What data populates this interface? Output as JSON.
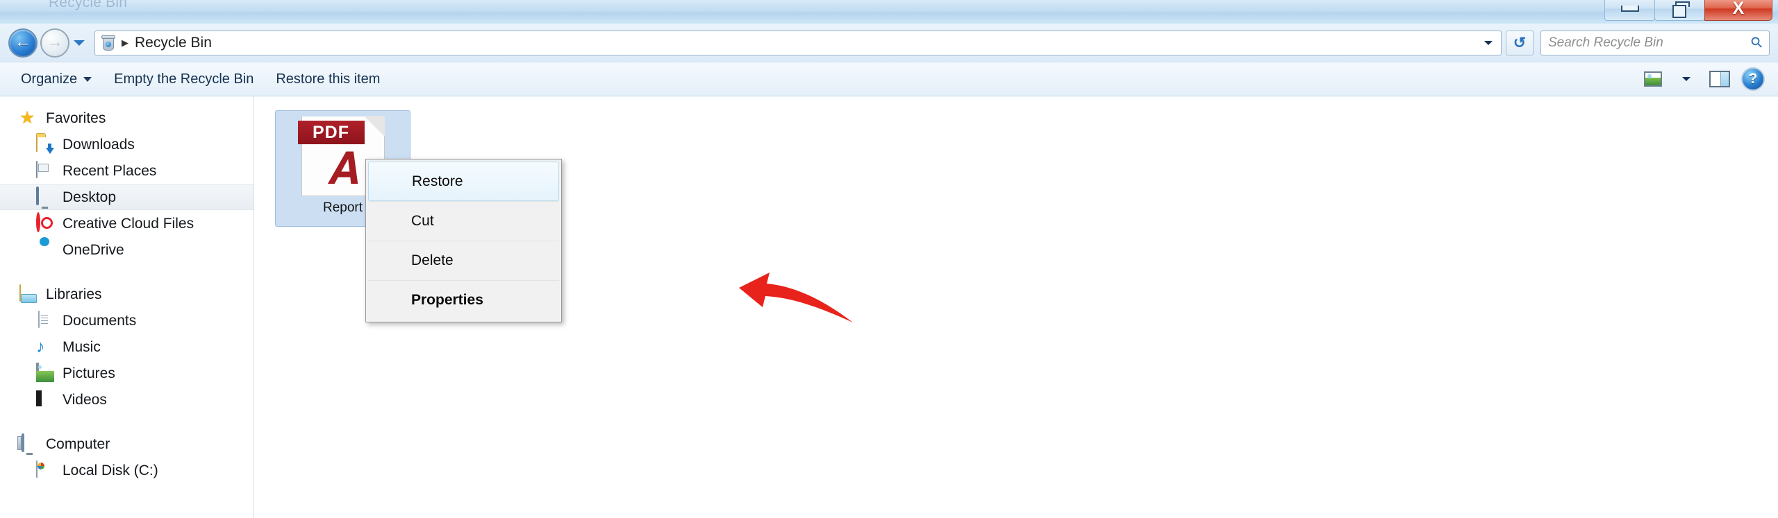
{
  "window": {
    "title": "Recycle Bin",
    "controls": {
      "minimize": "Minimize",
      "maximize": "Restore Down",
      "close": "X"
    }
  },
  "navbar": {
    "back_label": "←",
    "forward_label": "→",
    "history_label": "Recent pages",
    "address": {
      "icon": "recycle-bin-icon",
      "separator": "▶",
      "crumb": "Recycle Bin",
      "dropdown_label": "Previous locations"
    },
    "refresh_label": "↻",
    "search": {
      "placeholder": "Search Recycle Bin",
      "value": "",
      "icon": "⚲"
    }
  },
  "toolbar": {
    "organize_label": "Organize",
    "empty_label": "Empty the Recycle Bin",
    "restore_label": "Restore this item",
    "view_label": "Change your view",
    "view_dropdown_label": "More options",
    "preview_pane_label": "Show the preview pane",
    "help_label": "?"
  },
  "sidebar": {
    "groups": [
      {
        "header": {
          "label": "Favorites",
          "icon": "star-icon"
        },
        "items": [
          {
            "label": "Downloads",
            "icon": "downloads-folder-icon",
            "selected": false
          },
          {
            "label": "Recent Places",
            "icon": "recent-places-icon",
            "selected": false
          },
          {
            "label": "Desktop",
            "icon": "desktop-icon",
            "selected": true
          },
          {
            "label": "Creative Cloud Files",
            "icon": "creative-cloud-icon",
            "selected": false
          },
          {
            "label": "OneDrive",
            "icon": "onedrive-cloud-icon",
            "selected": false
          }
        ]
      },
      {
        "header": {
          "label": "Libraries",
          "icon": "libraries-icon"
        },
        "items": [
          {
            "label": "Documents",
            "icon": "document-icon",
            "selected": false
          },
          {
            "label": "Music",
            "icon": "music-note-icon",
            "selected": false
          },
          {
            "label": "Pictures",
            "icon": "picture-icon",
            "selected": false
          },
          {
            "label": "Videos",
            "icon": "video-icon",
            "selected": false
          }
        ]
      },
      {
        "header": {
          "label": "Computer",
          "icon": "computer-icon"
        },
        "items": [
          {
            "label": "Local Disk (C:)",
            "icon": "local-disk-icon",
            "selected": false
          }
        ]
      }
    ]
  },
  "content": {
    "files": [
      {
        "name": "Report",
        "type": "pdf",
        "badge": "PDF",
        "swoosh": "A",
        "selected": true
      }
    ]
  },
  "context_menu": {
    "items": [
      {
        "label": "Restore",
        "highlighted": true,
        "bold": false
      },
      {
        "label": "Cut",
        "highlighted": false,
        "bold": false
      },
      {
        "label": "Delete",
        "highlighted": false,
        "bold": false
      },
      {
        "label": "Properties",
        "highlighted": false,
        "bold": true
      }
    ]
  },
  "annotation": {
    "arrow_color": "#e8231c",
    "points_to": "Restore"
  },
  "colors": {
    "accent": "#2a7fd4",
    "close_red": "#cf3a22",
    "selection_blue": "#ccdef2",
    "pdf_red": "#a51c22",
    "annotation_red": "#e8231c"
  }
}
